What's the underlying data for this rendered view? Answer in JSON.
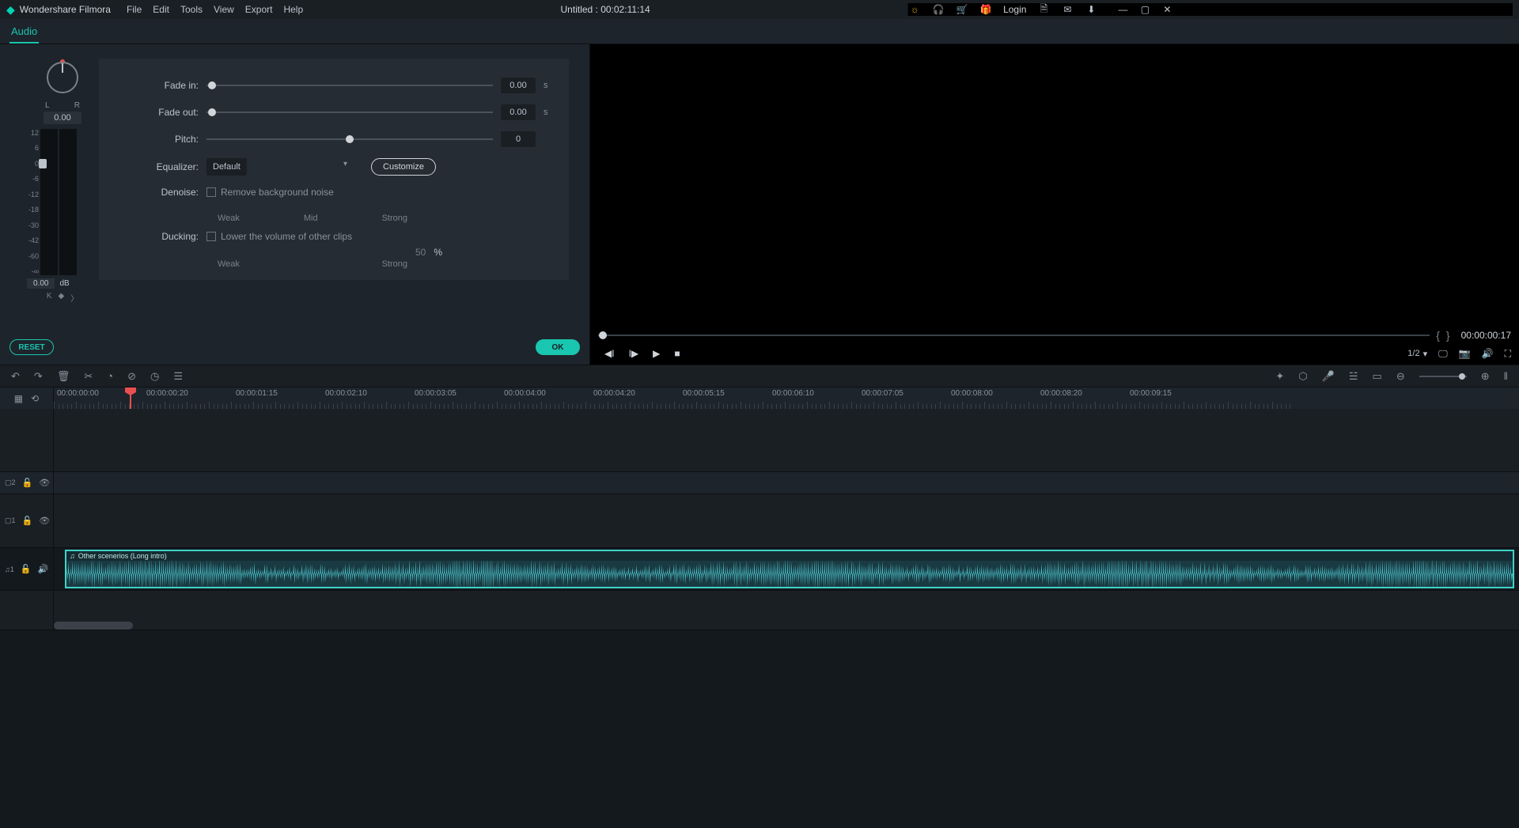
{
  "title": {
    "app": "Wondershare Filmora",
    "doc": "Untitled : 00:02:11:14"
  },
  "menu": [
    "File",
    "Edit",
    "Tools",
    "View",
    "Export",
    "Help"
  ],
  "titleright": {
    "login": "Login"
  },
  "tab": "Audio",
  "meter": {
    "L": "L",
    "R": "R",
    "knob": "0.00",
    "ticks": [
      "12",
      "6",
      "0",
      "-6",
      "-12",
      "-18",
      "-30",
      "-42",
      "-60",
      "-∞"
    ],
    "val": "0.00",
    "db": "dB"
  },
  "props": {
    "fadein": {
      "lbl": "Fade in:",
      "val": "0.00",
      "unit": "s"
    },
    "fadeout": {
      "lbl": "Fade out:",
      "val": "0.00",
      "unit": "s"
    },
    "pitch": {
      "lbl": "Pitch:",
      "val": "0"
    },
    "eq": {
      "lbl": "Equalizer:",
      "sel": "Default",
      "btn": "Customize"
    },
    "denoise": {
      "lbl": "Denoise:",
      "chk": "Remove background noise",
      "w": "Weak",
      "m": "Mid",
      "s": "Strong"
    },
    "ducking": {
      "lbl": "Ducking:",
      "chk": "Lower the volume of other clips",
      "val": "50",
      "unit": "%",
      "w": "Weak",
      "s": "Strong"
    }
  },
  "btns": {
    "reset": "RESET",
    "ok": "OK"
  },
  "preview": {
    "time": "00:00:00:17",
    "ratio": "1/2"
  },
  "ruler": [
    "00:00:00:00",
    "00:00:00:20",
    "00:00:01:15",
    "00:00:02:10",
    "00:00:03:05",
    "00:00:04:00",
    "00:00:04:20",
    "00:00:05:15",
    "00:00:06:10",
    "00:00:07:05",
    "00:00:08:00",
    "00:00:08:20",
    "00:00:09:15"
  ],
  "tracks": {
    "v2": "▢2",
    "v1": "▢1",
    "a1": "♫1",
    "clip": "Other scenerios  (Long intro)"
  }
}
